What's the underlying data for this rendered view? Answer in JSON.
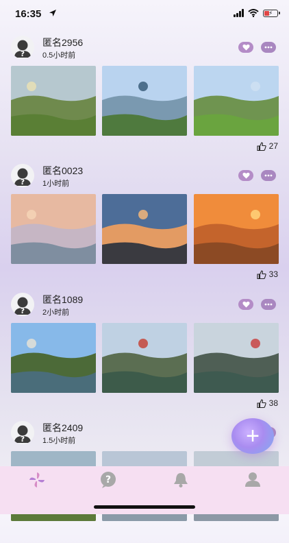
{
  "status": {
    "time": "16:35"
  },
  "posts": [
    {
      "user": "匿名2956",
      "time": "0.5小时前",
      "likes": "27",
      "photos": [
        {
          "sky": "#b6c8cf",
          "mid": "#6f8a4d",
          "ground": "#5a7f35",
          "accent": "#e9e1b5"
        },
        {
          "sky": "#b9d3ef",
          "mid": "#7a99b0",
          "ground": "#4f7a3e",
          "accent": "#3a5d7a"
        },
        {
          "sky": "#bcd6f0",
          "mid": "#6f9450",
          "ground": "#6aa43f",
          "accent": "#cfe0f2"
        }
      ]
    },
    {
      "user": "匿名0023",
      "time": "1小时前",
      "likes": "33",
      "photos": [
        {
          "sky": "#e7b9a1",
          "mid": "#c6b6c4",
          "ground": "#7f8ea0",
          "accent": "#f4d4b6"
        },
        {
          "sky": "#4d6d98",
          "mid": "#e39b63",
          "ground": "#3a3a40",
          "accent": "#f3b679"
        },
        {
          "sky": "#f08c3b",
          "mid": "#c4642c",
          "ground": "#8c4a24",
          "accent": "#ffd27a"
        }
      ]
    },
    {
      "user": "匿名1089",
      "time": "2小时前",
      "likes": "38",
      "photos": [
        {
          "sky": "#87b9e9",
          "mid": "#4c6a38",
          "ground": "#4a6d7a",
          "accent": "#e4e0d6"
        },
        {
          "sky": "#bfd1e3",
          "mid": "#5b6e52",
          "ground": "#3d5b4a",
          "accent": "#c4473b"
        },
        {
          "sky": "#c9d4dd",
          "mid": "#4f5f55",
          "ground": "#3e5a50",
          "accent": "#c94343"
        }
      ]
    },
    {
      "user": "匿名2409",
      "time": "1.5小时前",
      "likes": "",
      "photos": [
        {
          "sky": "#9fb6c6",
          "mid": "#c07a2e",
          "ground": "#5c7a3a",
          "accent": "#e88a2a"
        },
        {
          "sky": "#b9c6d6",
          "mid": "#a8b7c9",
          "ground": "#8a9aa8",
          "accent": "#d0dae4"
        },
        {
          "sky": "#c2ccd6",
          "mid": "#a9b4c1",
          "ground": "#8c98a5",
          "accent": "#d6dde5"
        }
      ]
    }
  ],
  "colors": {
    "accent": "#b48cc7",
    "tabbar": "#f6dff2"
  },
  "tabs": [
    {
      "icon": "pinwheel-icon"
    },
    {
      "icon": "question-bubble-icon"
    },
    {
      "icon": "bell-icon"
    },
    {
      "icon": "profile-icon"
    }
  ]
}
